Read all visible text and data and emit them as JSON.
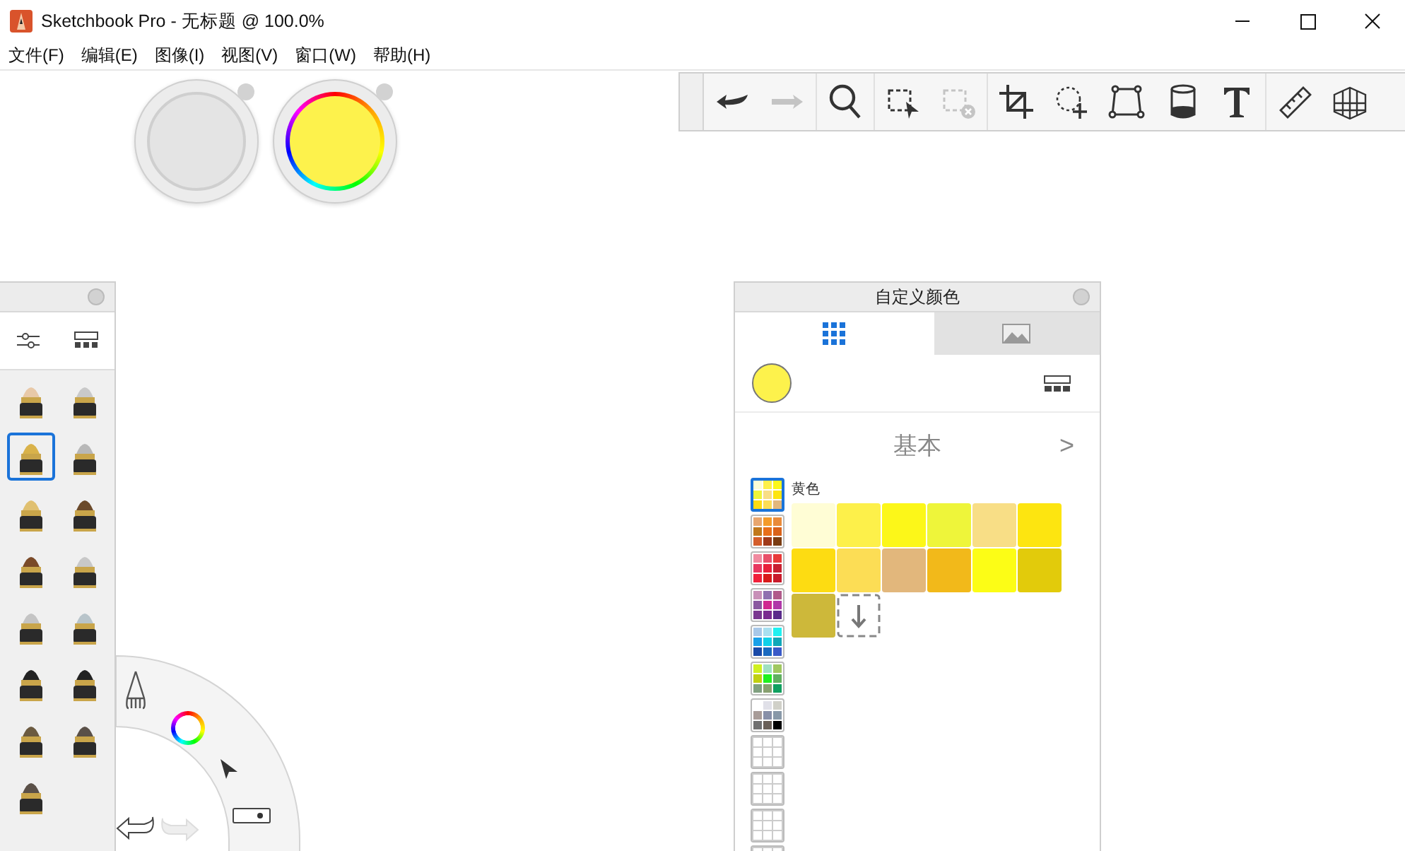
{
  "window": {
    "title": "Sketchbook Pro - 无标题 @ 100.0%"
  },
  "menu": [
    "文件(F)",
    "编辑(E)",
    "图像(I)",
    "视图(V)",
    "窗口(W)",
    "帮助(H)"
  ],
  "current": {
    "color": "#fdf24c"
  },
  "toolbar": {
    "groups": [
      [
        {
          "kind": "undo",
          "disabled": false
        },
        {
          "kind": "redo",
          "disabled": true
        }
      ],
      [
        {
          "kind": "zoom",
          "disabled": false
        }
      ],
      [
        {
          "kind": "select",
          "disabled": false
        },
        {
          "kind": "clear-select",
          "disabled": true
        }
      ],
      [
        {
          "kind": "crop",
          "disabled": false
        },
        {
          "kind": "lasso",
          "disabled": false
        },
        {
          "kind": "transform",
          "disabled": false
        },
        {
          "kind": "fill",
          "disabled": false
        },
        {
          "kind": "text",
          "disabled": false
        }
      ],
      [
        {
          "kind": "ruler",
          "disabled": false
        },
        {
          "kind": "perspective",
          "disabled": false
        }
      ]
    ]
  },
  "brush_palette": {
    "brushes": [
      {
        "kind": "pencil",
        "selected": false
      },
      {
        "kind": "airbrush",
        "selected": false
      },
      {
        "kind": "inkpen",
        "selected": true
      },
      {
        "kind": "ballpoint",
        "selected": false
      },
      {
        "kind": "fountain",
        "selected": false
      },
      {
        "kind": "round",
        "selected": false
      },
      {
        "kind": "paint",
        "selected": false
      },
      {
        "kind": "soft",
        "selected": false
      },
      {
        "kind": "marker",
        "selected": false
      },
      {
        "kind": "chisel",
        "selected": false
      },
      {
        "kind": "felt",
        "selected": false
      },
      {
        "kind": "felt",
        "selected": false
      },
      {
        "kind": "bristle",
        "selected": false
      },
      {
        "kind": "flat",
        "selected": false
      },
      {
        "kind": "flat",
        "selected": false
      }
    ]
  },
  "color_editor": {
    "title": "自定义颜色",
    "tabs": [
      {
        "kind": "swatches",
        "selected": true
      },
      {
        "kind": "image",
        "selected": false
      }
    ],
    "set_name": "基本",
    "next": ">",
    "group_label": "黄色",
    "sets": [
      {
        "selected": true,
        "cells": [
          {
            "color": "#fdfdd6"
          },
          {
            "color": "#fdf04a"
          },
          {
            "color": "#fcf719"
          },
          {
            "color": "#eef53a"
          },
          {
            "color": "#f8de86"
          },
          {
            "color": "#fde510"
          },
          {
            "color": "#fddc12"
          },
          {
            "color": "#fcdd55"
          },
          {
            "color": "#e2b77c"
          }
        ]
      },
      {
        "selected": false,
        "cells": [
          {
            "color": "#e8a66e"
          },
          {
            "color": "#f49b2a"
          },
          {
            "color": "#e98a3a"
          },
          {
            "color": "#c0781c"
          },
          {
            "color": "#e86f1a"
          },
          {
            "color": "#d9621a"
          },
          {
            "color": "#d45e2c"
          },
          {
            "color": "#a03a1a"
          },
          {
            "color": "#7a3c12"
          }
        ]
      },
      {
        "selected": false,
        "cells": [
          {
            "color": "#f08aa0"
          },
          {
            "color": "#e8506a"
          },
          {
            "color": "#e83a3a"
          },
          {
            "color": "#e83860"
          },
          {
            "color": "#e8203a"
          },
          {
            "color": "#c82030"
          },
          {
            "color": "#f0203a"
          },
          {
            "color": "#d81a1a"
          },
          {
            "color": "#c81a2a"
          }
        ]
      },
      {
        "selected": false,
        "cells": [
          {
            "color": "#c890b8"
          },
          {
            "color": "#9070b0"
          },
          {
            "color": "#b05a8a"
          },
          {
            "color": "#8a5aa0"
          },
          {
            "color": "#d02890"
          },
          {
            "color": "#b038a8"
          },
          {
            "color": "#7a3890"
          },
          {
            "color": "#7a2a90"
          },
          {
            "color": "#5a2a8a"
          }
        ]
      },
      {
        "selected": false,
        "cells": [
          {
            "color": "#a8c8e8"
          },
          {
            "color": "#a8e0f0"
          },
          {
            "color": "#20f0f0"
          },
          {
            "color": "#1aa0e8"
          },
          {
            "color": "#10d0e8"
          },
          {
            "color": "#10a8b8"
          },
          {
            "color": "#1a4aa8"
          },
          {
            "color": "#1a6ac0"
          },
          {
            "color": "#3a5ac8"
          }
        ]
      },
      {
        "selected": false,
        "cells": [
          {
            "color": "#d0f020"
          },
          {
            "color": "#a0e0c0"
          },
          {
            "color": "#a0c860"
          },
          {
            "color": "#c0d010"
          },
          {
            "color": "#20f020"
          },
          {
            "color": "#60b060"
          },
          {
            "color": "#80a080"
          },
          {
            "color": "#88a070"
          },
          {
            "color": "#10a060"
          }
        ]
      },
      {
        "selected": false,
        "cells": [
          {
            "color": "#ffffff"
          },
          {
            "color": "#e0e0e8"
          },
          {
            "color": "#d0d0c8"
          },
          {
            "color": "#a89c98"
          },
          {
            "color": "#8890a8"
          },
          {
            "color": "#8898a8"
          },
          {
            "color": "#707070"
          },
          {
            "color": "#6a6058"
          },
          {
            "color": "#000000"
          }
        ]
      },
      {
        "selected": false
      },
      {
        "selected": false
      },
      {
        "selected": false
      },
      {
        "selected": false
      }
    ],
    "swatches": [
      {
        "color": "#fffdd5"
      },
      {
        "color": "#fdf04a"
      },
      {
        "color": "#fcf719"
      },
      {
        "color": "#eef53a"
      },
      {
        "color": "#f8de86"
      },
      {
        "color": "#fde510"
      },
      {
        "color": "#fddc12"
      },
      {
        "color": "#fcdd55"
      },
      {
        "color": "#e2b77c"
      },
      {
        "color": "#f2b91a"
      },
      {
        "color": "#fcfd16"
      },
      {
        "color": "#e2cb0b"
      },
      {
        "color": "#cdb83a"
      }
    ]
  }
}
